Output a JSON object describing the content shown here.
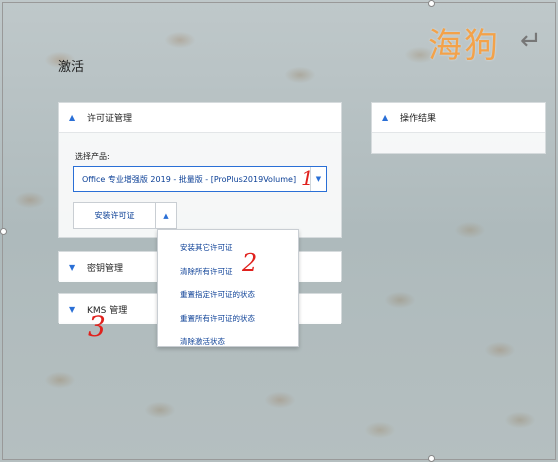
{
  "watermark": {
    "text": "海狗",
    "arrow": "↵"
  },
  "page": {
    "title": "激活"
  },
  "license_panel": {
    "title": "许可证管理",
    "select_label": "选择产品:",
    "selected_product": "Office 专业增强版 2019 - 批量版 - [ProPlus2019Volume]",
    "install_button": "安装许可证"
  },
  "result_panel": {
    "title": "操作结果"
  },
  "key_panel": {
    "title": "密钥管理"
  },
  "kms_panel": {
    "title": "KMS 管理"
  },
  "dropdown_menu": {
    "items": [
      "安装其它许可证",
      "清除所有许可证",
      "重置指定许可证的状态",
      "重置所有许可证的状态",
      "清除激活状态"
    ]
  },
  "annotations": {
    "one": "1",
    "two": "2",
    "three": "3"
  },
  "colors": {
    "accent": "#2a6fd6",
    "link_text": "#0b3f96",
    "annotation": "#e0211d",
    "watermark": "#f3a24a"
  }
}
